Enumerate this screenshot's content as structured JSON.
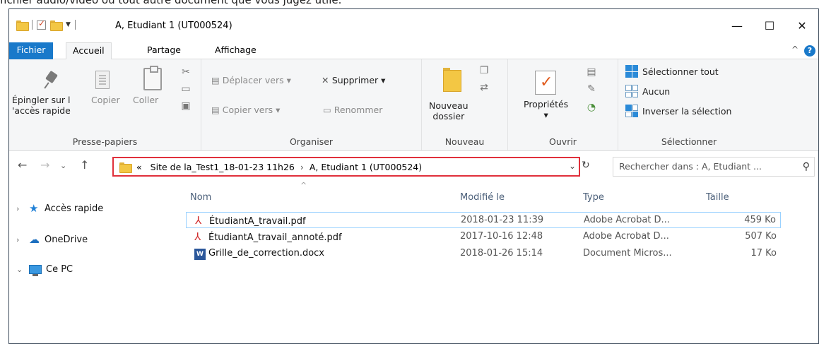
{
  "caption": "fichier audio/vidéo ou tout autre document que vous jugez utile.",
  "window": {
    "title": "A, Etudiant 1 (UT000524)",
    "minimize": "—",
    "maximize": "☐",
    "close": "✕"
  },
  "tabs": {
    "file": "Fichier",
    "home": "Accueil",
    "share": "Partage",
    "view": "Affichage",
    "help": "?",
    "collapse": "^"
  },
  "ribbon": {
    "clipboard": {
      "label": "Presse-papiers",
      "pin_line1": "Épingler sur l",
      "pin_line2": "'accès rapide",
      "copy": "Copier",
      "paste": "Coller"
    },
    "organize": {
      "label": "Organiser",
      "move_to": "Déplacer vers",
      "copy_to": "Copier vers",
      "delete": "Supprimer",
      "rename": "Renommer"
    },
    "new": {
      "label": "Nouveau",
      "new_folder_line1": "Nouveau",
      "new_folder_line2": "dossier"
    },
    "open": {
      "label": "Ouvrir",
      "properties": "Propriétés"
    },
    "select": {
      "label": "Sélectionner",
      "select_all": "Sélectionner tout",
      "select_none": "Aucun",
      "invert": "Inverser la sélection"
    }
  },
  "address": {
    "overflow": "«",
    "crumbs": [
      "Site de la_Test1_18-01-23 11h26",
      "A, Etudiant 1 (UT000524)"
    ],
    "separator": "›",
    "search_placeholder": "Rechercher dans : A, Etudiant ...",
    "accent_color": "#e0303b"
  },
  "navpane": [
    {
      "label": "Accès rapide",
      "expander": "›"
    },
    {
      "label": "OneDrive",
      "expander": "›"
    },
    {
      "label": "Ce PC",
      "expander": "⌄"
    }
  ],
  "columns": {
    "name": "Nom",
    "modified": "Modifié le",
    "type": "Type",
    "size": "Taille"
  },
  "files": [
    {
      "name": "ÉtudiantA_travail.pdf",
      "modified": "2018-01-23 11:39",
      "type": "Adobe Acrobat D...",
      "size": "459 Ko",
      "icon": "pdf-icon"
    },
    {
      "name": "ÉtudiantA_travail_annoté.pdf",
      "modified": "2017-10-16 12:48",
      "type": "Adobe Acrobat D...",
      "size": "507 Ko",
      "icon": "pdf-icon"
    },
    {
      "name": "Grille_de_correction.docx",
      "modified": "2018-01-26 15:14",
      "type": "Document Micros...",
      "size": "17 Ko",
      "icon": "word-icon"
    }
  ]
}
